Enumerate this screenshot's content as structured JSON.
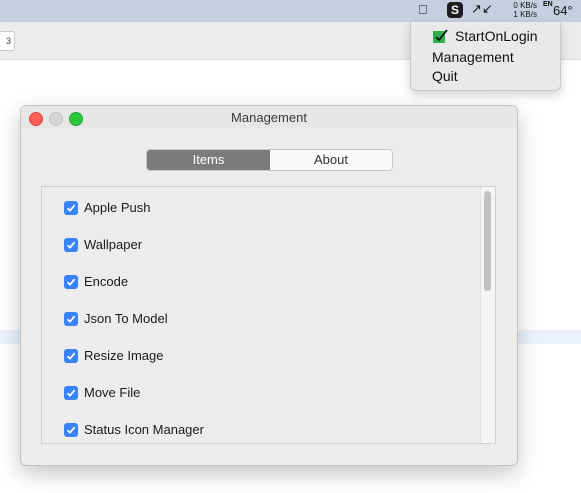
{
  "menubar": {
    "net_up": "0 KB/s",
    "net_down": "1 KB/s",
    "input_lang": "EN",
    "temperature": "64°",
    "s_icon_label": "S"
  },
  "background": {
    "tab_fragment": "3"
  },
  "dropdown": {
    "items": [
      {
        "label": "StartOnLogin",
        "checked": true
      },
      {
        "label": "Management"
      },
      {
        "label": "Quit"
      }
    ]
  },
  "window": {
    "title": "Management",
    "tabs": [
      {
        "label": "Items",
        "selected": true
      },
      {
        "label": "About",
        "selected": false
      }
    ],
    "items": [
      {
        "label": "Apple Push",
        "checked": true
      },
      {
        "label": "Wallpaper",
        "checked": true
      },
      {
        "label": "Encode",
        "checked": true
      },
      {
        "label": "Json To Model",
        "checked": true
      },
      {
        "label": "Resize Image",
        "checked": true
      },
      {
        "label": "Move File",
        "checked": true
      },
      {
        "label": "Status Icon Manager",
        "checked": true
      }
    ]
  },
  "colors": {
    "checkbox": "#3a83f6",
    "segment_selected": "#7b7b7b",
    "close": "#fd5e57",
    "zoom": "#2ac73f",
    "startonlogin_icon": "#2db04b"
  }
}
